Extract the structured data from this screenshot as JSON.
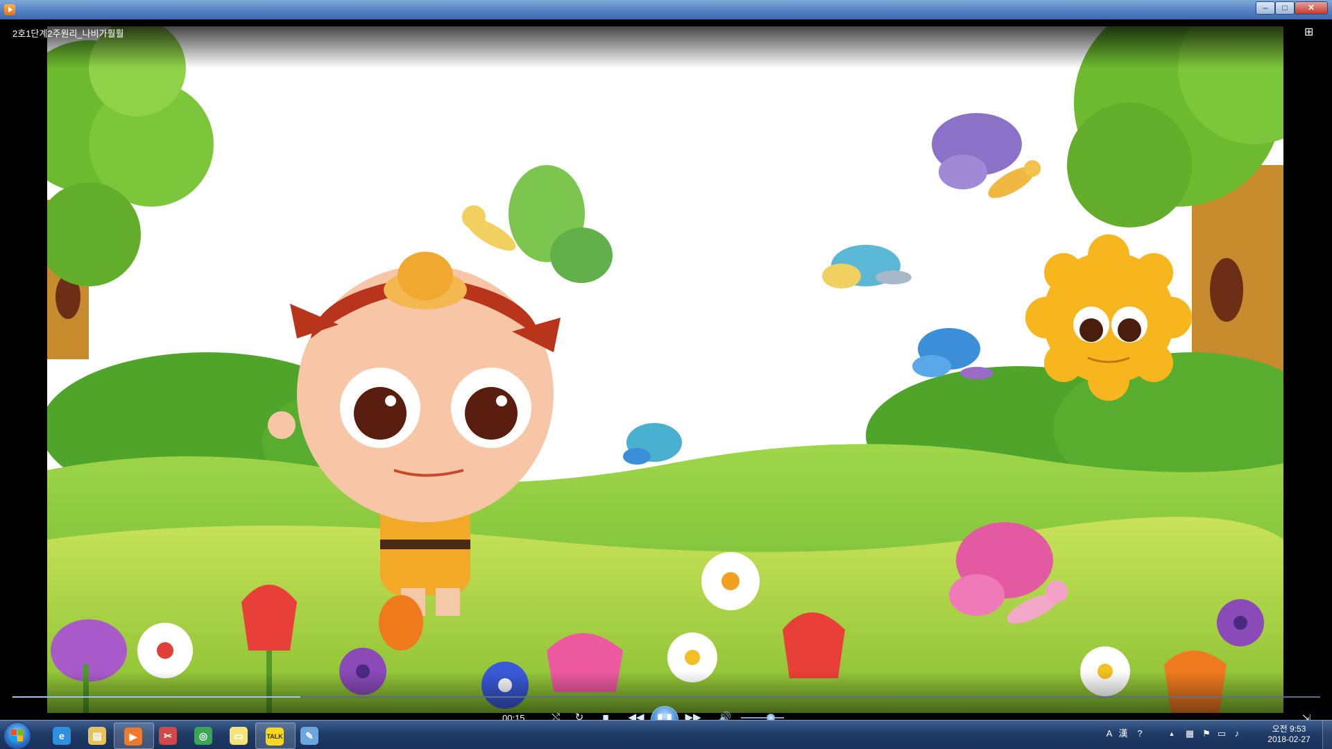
{
  "window": {
    "title_bar_text": "",
    "buttons": {
      "minimize": "–",
      "maximize": "□",
      "close": "✕"
    }
  },
  "player": {
    "video_title": "2호1단계2주원리_나비가훨훨",
    "elapsed_time": "00:15",
    "playback_progress": 0.22,
    "volume_level": 0.7,
    "state": "playing",
    "controls": {
      "shuffle": "⤭",
      "repeat": "↻",
      "stop": "■",
      "previous": "◀◀",
      "pause": "❚❚",
      "next": "▶▶",
      "volume": "🔊",
      "switch_view": "⇲",
      "layout_toggle": "⊞"
    }
  },
  "taskbar": {
    "pinned": [
      {
        "name": "internet-explorer",
        "glyph": "e",
        "color": "#2f8fe0",
        "active": false
      },
      {
        "name": "file-explorer",
        "glyph": "▤",
        "color": "#e8c25a",
        "active": false
      },
      {
        "name": "media-player",
        "glyph": "▶",
        "color": "#f07a2a",
        "active": true
      },
      {
        "name": "snipping-tool",
        "glyph": "✂",
        "color": "#d04848",
        "active": false
      },
      {
        "name": "chrome",
        "glyph": "◎",
        "color": "#3aa655",
        "active": false
      },
      {
        "name": "sticky-notes",
        "glyph": "▭",
        "color": "#f4e27a",
        "active": false
      },
      {
        "name": "kakaotalk",
        "glyph": "TALK",
        "color": "#f7d81e",
        "active": true
      },
      {
        "name": "paint",
        "glyph": "✎",
        "color": "#6ba6de",
        "active": false
      }
    ],
    "tray": {
      "ime_mode": "A",
      "ime_hanja": "漢",
      "help": "?",
      "up_arrow": "▲"
    },
    "clock": {
      "time": "오전 9:53",
      "date": "2018-02-27"
    }
  }
}
